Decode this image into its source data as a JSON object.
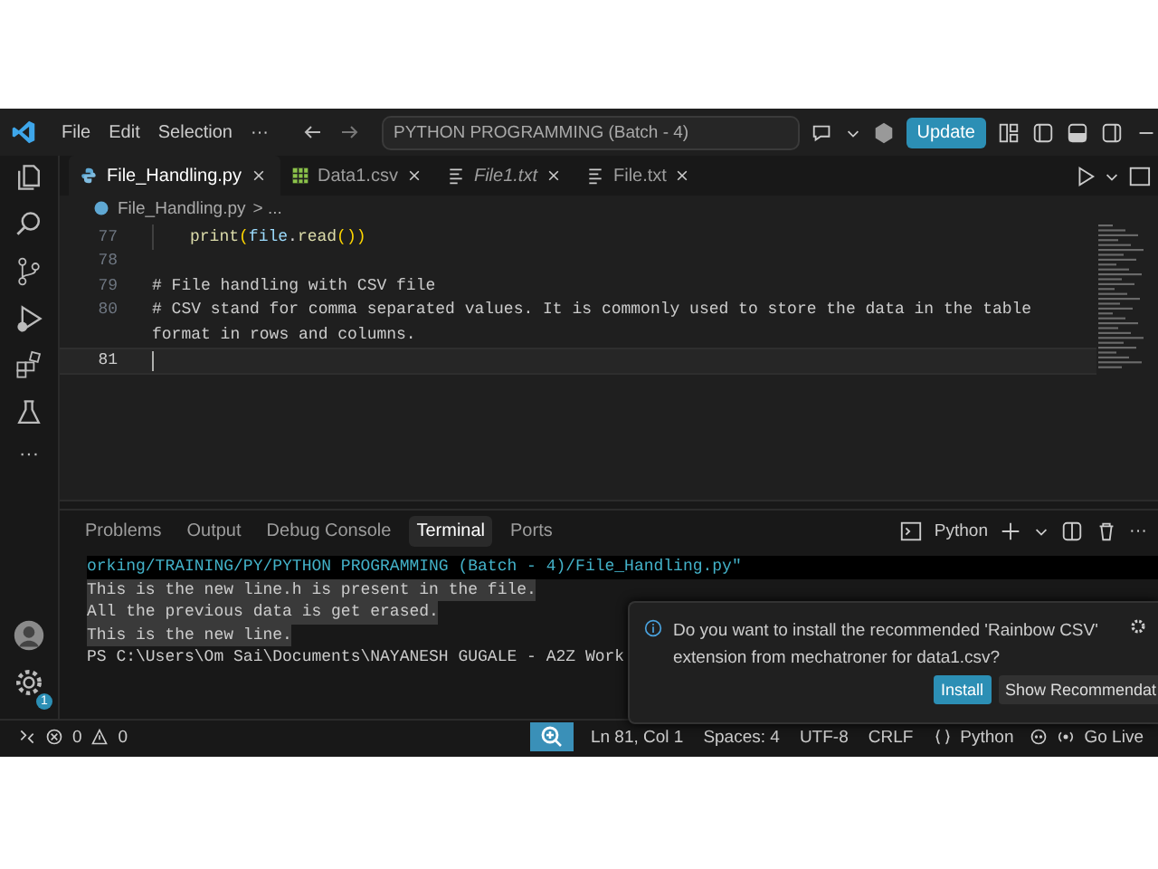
{
  "title_bar": {
    "menu": [
      "File",
      "Edit",
      "Selection",
      "···"
    ],
    "command_center": "PYTHON PROGRAMMING (Batch - 4)",
    "update_button": "Update"
  },
  "tabs": [
    {
      "label": "File_Handling.py",
      "kind": "python",
      "italic": false,
      "selected": true
    },
    {
      "label": "Data1.csv",
      "kind": "csv",
      "italic": false,
      "selected": false
    },
    {
      "label": "File1.txt",
      "kind": "text",
      "italic": true,
      "selected": false
    },
    {
      "label": "File.txt",
      "kind": "text",
      "italic": false,
      "selected": false
    }
  ],
  "breadcrumb": {
    "file": "File_Handling.py",
    "rest": "> ..."
  },
  "activity_bar": {
    "more": "···",
    "settings_badge": "1"
  },
  "editor": {
    "lines": [
      {
        "number": "77",
        "current": false,
        "indent": true,
        "tokens": [
          {
            "text": "print",
            "kind": "function"
          },
          {
            "text": "(",
            "kind": "paren"
          },
          {
            "text": "file",
            "kind": "variable"
          },
          {
            "text": ".",
            "kind": "plain"
          },
          {
            "text": "read",
            "kind": "function"
          },
          {
            "text": "())",
            "kind": "paren"
          }
        ]
      },
      {
        "number": "78",
        "current": false
      },
      {
        "number": "79",
        "current": false,
        "tokens": [
          {
            "text": "# File handling with CSV file",
            "kind": "comment"
          }
        ]
      },
      {
        "number": "80",
        "current": false,
        "tokens": [
          {
            "text": "# CSV stand for comma separated values. It is commonly used to store the data in the table",
            "kind": "comment"
          }
        ],
        "wrapped": "format in rows and columns."
      },
      {
        "number": "81",
        "current": true
      }
    ]
  },
  "panel": {
    "tabs": [
      {
        "label": "Problems",
        "selected": false
      },
      {
        "label": "Output",
        "selected": false
      },
      {
        "label": "Debug Console",
        "selected": false
      },
      {
        "label": "Terminal",
        "selected": true
      },
      {
        "label": "Ports",
        "selected": false
      }
    ],
    "shell": "Python",
    "terminal": [
      {
        "text": "orking/TRAINING/PY/PYTHON PROGRAMMING (Batch - 4)/File_Handling.py\"",
        "kind": "command"
      },
      {
        "text": "This is the new line.h is present in the file.",
        "kind": "highlighted"
      },
      {
        "text": "All the previous data is get erased.",
        "kind": "highlighted"
      },
      {
        "text": "This is the new line.",
        "kind": "highlighted"
      },
      {
        "text": "PS C:\\Users\\Om Sai\\Documents\\NAYANESH GUGALE - A2Z Work",
        "kind": "prompt"
      }
    ]
  },
  "notification": {
    "message": "Do you want to install the recommended 'Rainbow CSV' extension from mechatroner for data1.csv?",
    "buttons": [
      {
        "label": "Install",
        "primary": true
      },
      {
        "label": "Show Recommendat",
        "primary": false
      }
    ]
  },
  "status_bar": {
    "errors": "0",
    "warnings": "0",
    "items": [
      "Ln 81, Col 1",
      "Spaces: 4",
      "UTF-8",
      "CRLF"
    ],
    "language": "Python",
    "live": "Go Live"
  }
}
